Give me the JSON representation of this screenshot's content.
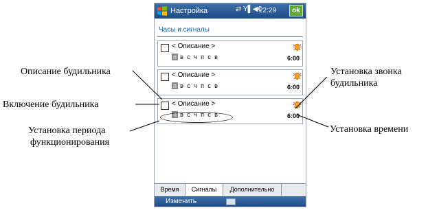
{
  "titlebar": {
    "title": "Настройка",
    "clock": "22:29",
    "ok_label": "ok",
    "status_icons": "⇄ Y▌◀€"
  },
  "page": {
    "subtitle": "Часы и сигналы"
  },
  "alarms": [
    {
      "desc": "< Описание >",
      "days": [
        "п",
        "в",
        "с",
        "ч",
        "п",
        "с",
        "в"
      ],
      "time": "6:00"
    },
    {
      "desc": "< Описание >",
      "days": [
        "п",
        "в",
        "с",
        "ч",
        "п",
        "с",
        "в"
      ],
      "time": "6:00"
    },
    {
      "desc": "< Описание >",
      "days": [
        "п",
        "в",
        "с",
        "ч",
        "п",
        "с",
        "в"
      ],
      "time": "6:00"
    }
  ],
  "tabs": [
    "Время",
    "Сигналы",
    "Дополнительно"
  ],
  "bottom": {
    "left_label": "Изменить"
  },
  "callouts": {
    "description": "Описание будильника",
    "enable": "Включение будильника",
    "period_line1": "Установка периода",
    "period_line2": "функционирования",
    "sound_line1": "Установка звонка",
    "sound_line2": "будильника",
    "time": "Установка времени"
  },
  "colors": {
    "titlebar": "#2c5a94",
    "ok_button": "#5fa836",
    "subtitle_text": "#1b5fa5"
  }
}
